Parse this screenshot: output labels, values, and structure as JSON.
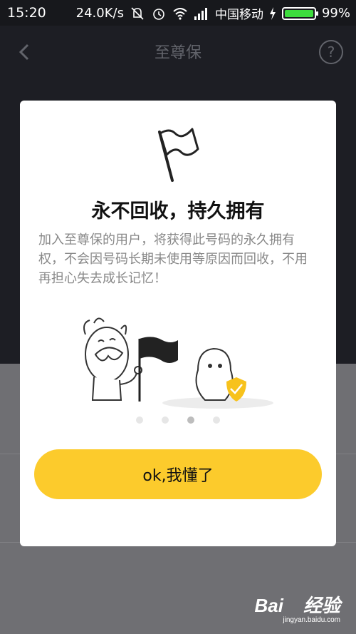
{
  "status_bar": {
    "time": "15:20",
    "speed": "24.0K/s",
    "carrier": "中国移动",
    "battery": "99%",
    "battery_level": 0.99,
    "icons": [
      "mute-icon",
      "alarm-icon",
      "wifi-icon",
      "signal-icon",
      "charging-icon"
    ]
  },
  "app_bar": {
    "title": "至尊保",
    "back_icon": "chevron-left-icon",
    "help_label": "?"
  },
  "dialog": {
    "icon": "flag-icon",
    "title": "永不回收，持久拥有",
    "description": "加入至尊保的用户，将获得此号码的永久拥有权，不会因号码长期未使用等原因而回收，不用再担心失去成长记忆！",
    "illustration": "mascot-with-flag-and-penguin-shield",
    "pager": {
      "count": 4,
      "active_index": 2
    },
    "confirm_button": "ok,我懂了"
  },
  "watermark": {
    "logo": "Bai 经验",
    "url": "jingyan.baidu.com"
  },
  "colors": {
    "accent": "#fccb2c",
    "app_bar_bg": "#1d1e24",
    "overlay_bg": "#6f6f73",
    "shield": "#f7c21c"
  }
}
